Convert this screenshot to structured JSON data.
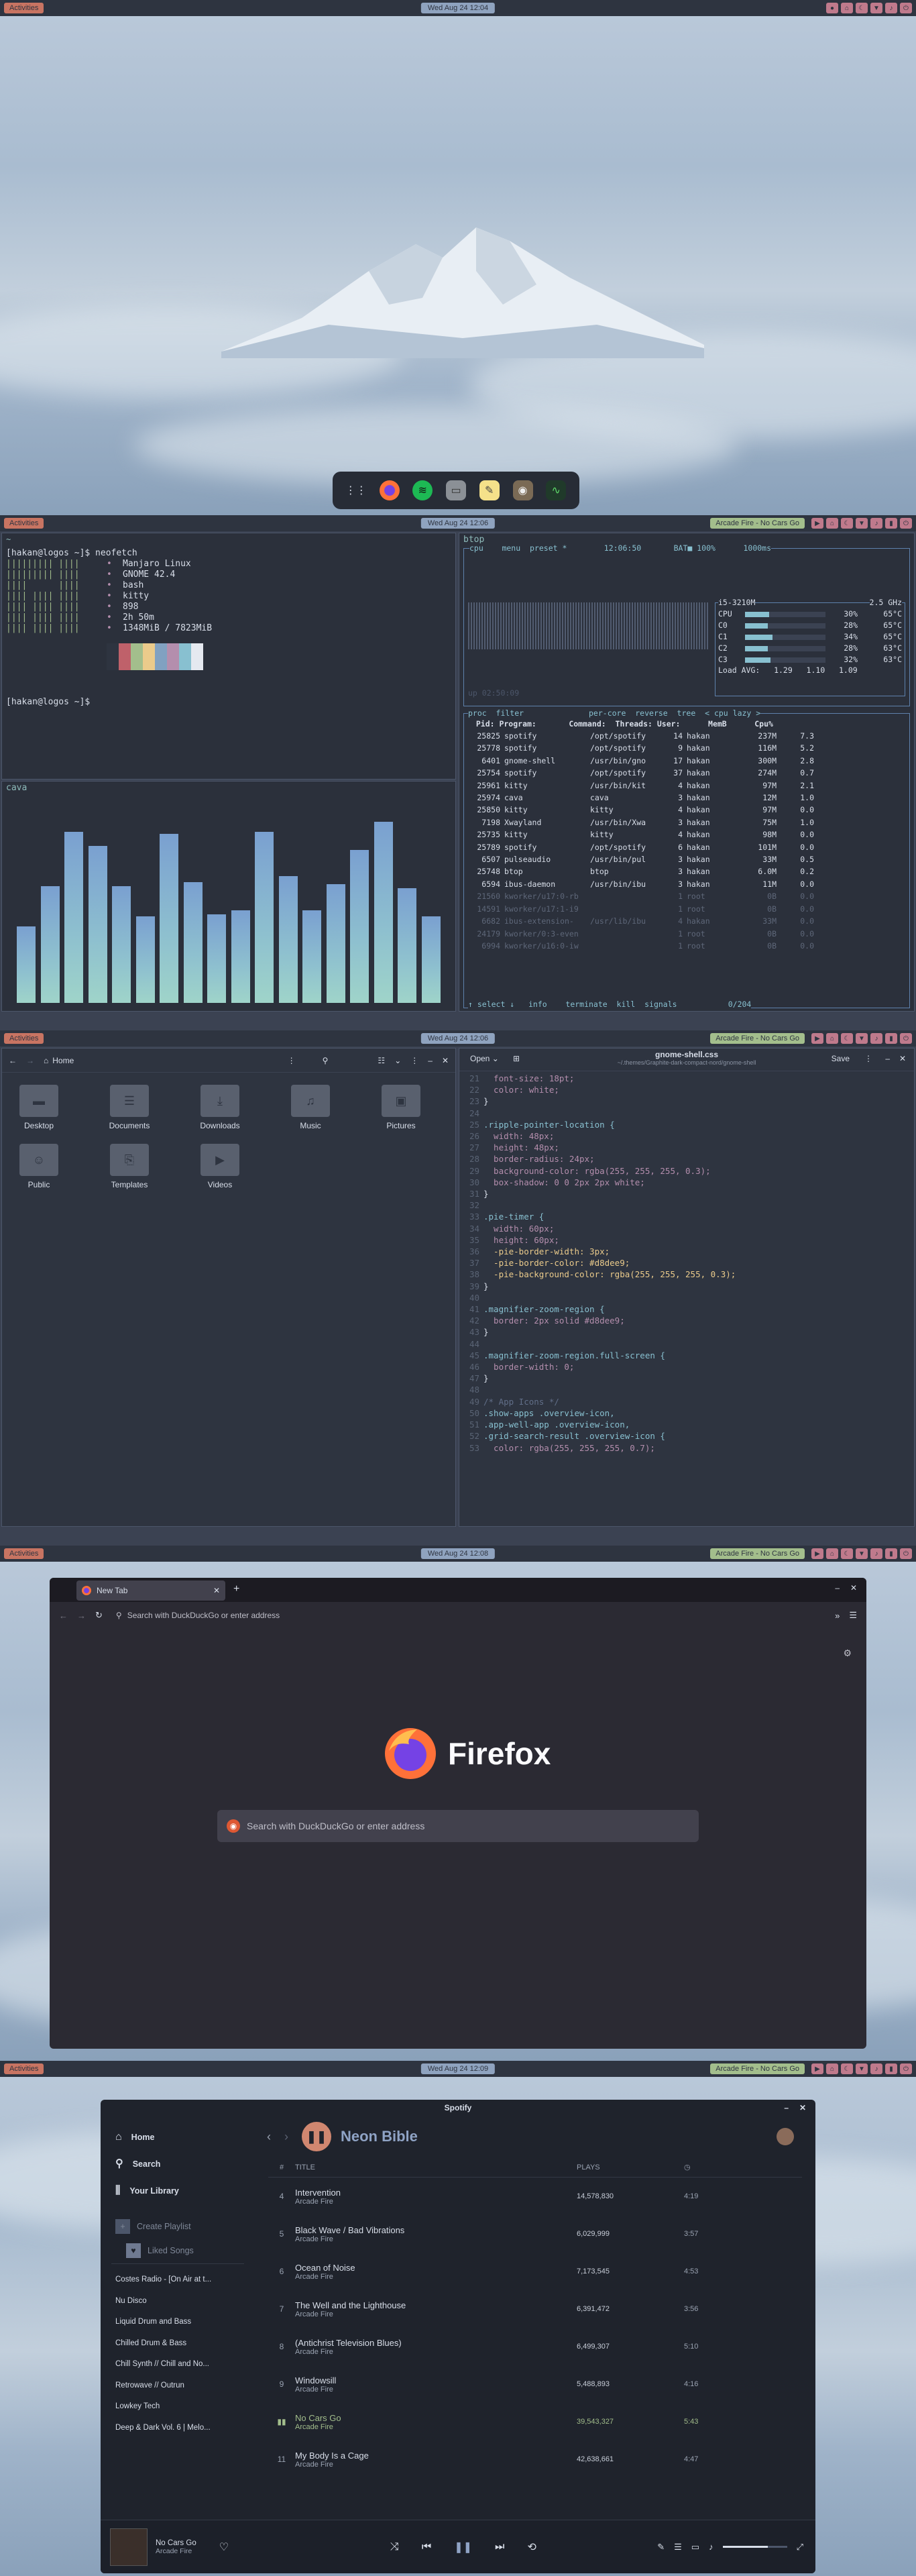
{
  "screens": [
    {
      "activities": "Activities",
      "clock": "Wed Aug 24 12:04"
    },
    {
      "activities": "Activities",
      "clock": "Wed Aug 24 12:06",
      "music": "Arcade Fire - No Cars Go"
    },
    {
      "activities": "Activities",
      "clock": "Wed Aug 24 12:06",
      "music": "Arcade Fire - No Cars Go"
    },
    {
      "activities": "Activities",
      "clock": "Wed Aug 24 12:08",
      "music": "Arcade Fire - No Cars Go"
    },
    {
      "activities": "Activities",
      "clock": "Wed Aug 24 12:09",
      "music": "Arcade Fire - No Cars Go"
    }
  ],
  "dock": [
    "apps-grid-icon",
    "firefox-icon",
    "spotify-icon",
    "files-icon",
    "notes-icon",
    "gimp-icon",
    "system-monitor-icon"
  ],
  "term_left": {
    "prompt1": "[hakan@logos ~]$ neofetch",
    "prompt2": "[hakan@logos ~]$",
    "title": "~",
    "logo": [
      "||||||||| ||||",
      "||||||||| ||||",
      "||||      ||||",
      "|||| |||| ||||",
      "|||| |||| ||||",
      "|||| |||| ||||",
      "|||| |||| ||||"
    ],
    "info": [
      "Manjaro Linux",
      "GNOME 42.4",
      "bash",
      "kitty",
      "898",
      "2h 50m",
      "1348MiB / 7823MiB"
    ],
    "palette": [
      "#2e3440",
      "#bf616a",
      "#a3be8c",
      "#ebcb8b",
      "#81a1c1",
      "#b48ead",
      "#88c0d0",
      "#e5e9f0"
    ],
    "cava_title": "cava",
    "cava_levels": [
      0.38,
      0.58,
      0.85,
      0.78,
      0.58,
      0.43,
      0.84,
      0.6,
      0.44,
      0.46,
      0.85,
      0.63,
      0.46,
      0.59,
      0.76,
      0.9,
      0.57,
      0.43
    ]
  },
  "btop": {
    "title": "btop",
    "header": "cpu    menu  preset *        12:06:50       BAT■ 100%      1000ms",
    "cpu_model": "i5-3210M",
    "ghz": "2.5 GHz",
    "cores": [
      [
        "CPU",
        "30%",
        "65°C"
      ],
      [
        "C0",
        "28%",
        "65°C"
      ],
      [
        "C1",
        "34%",
        "65°C"
      ],
      [
        "C2",
        "28%",
        "63°C"
      ],
      [
        "C3",
        "32%",
        "63°C"
      ]
    ],
    "load": "Load AVG:   1.29   1.10   1.09",
    "uptime": "up 02:50:09",
    "proc_header": "proc  filter              per-core  reverse  tree  < cpu lazy >",
    "cols": "  Pid: Program:       Command:  Threads: User:      MemB      Cpu%",
    "rows": [
      [
        "25825",
        "spotify",
        "/opt/spotify",
        "14",
        "hakan",
        "237M",
        "7.3"
      ],
      [
        "25778",
        "spotify",
        "/opt/spotify",
        "9",
        "hakan",
        "116M",
        "5.2"
      ],
      [
        "6401",
        "gnome-shell",
        "/usr/bin/gno",
        "17",
        "hakan",
        "300M",
        "2.8"
      ],
      [
        "25754",
        "spotify",
        "/opt/spotify",
        "37",
        "hakan",
        "274M",
        "0.7"
      ],
      [
        "25961",
        "kitty",
        "/usr/bin/kit",
        "4",
        "hakan",
        "97M",
        "2.1"
      ],
      [
        "25974",
        "cava",
        "cava",
        "3",
        "hakan",
        "12M",
        "1.0"
      ],
      [
        "25850",
        "kitty",
        "kitty",
        "4",
        "hakan",
        "97M",
        "0.0"
      ],
      [
        "7198",
        "Xwayland",
        "/usr/bin/Xwa",
        "3",
        "hakan",
        "75M",
        "1.0"
      ],
      [
        "25735",
        "kitty",
        "kitty",
        "4",
        "hakan",
        "98M",
        "0.0"
      ],
      [
        "25789",
        "spotify",
        "/opt/spotify",
        "6",
        "hakan",
        "101M",
        "0.0"
      ],
      [
        "6507",
        "pulseaudio",
        "/usr/bin/pul",
        "3",
        "hakan",
        "33M",
        "0.5"
      ],
      [
        "25748",
        "btop",
        "btop",
        "3",
        "hakan",
        "6.0M",
        "0.2"
      ],
      [
        "6594",
        "ibus-daemon",
        "/usr/bin/ibu",
        "3",
        "hakan",
        "11M",
        "0.0"
      ],
      [
        "21560",
        "kworker/u17:0-rb",
        "",
        "1",
        "root",
        "0B",
        "0.0"
      ],
      [
        "14591",
        "kworker/u17:1-i9",
        "",
        "1",
        "root",
        "0B",
        "0.0"
      ],
      [
        "6682",
        "ibus-extension-",
        "/usr/lib/ibu",
        "4",
        "hakan",
        "33M",
        "0.0"
      ],
      [
        "24179",
        "kworker/0:3-even",
        "",
        "1",
        "root",
        "0B",
        "0.0"
      ],
      [
        "6994",
        "kworker/u16:0-iw",
        "",
        "1",
        "root",
        "0B",
        "0.0"
      ]
    ],
    "footer": "↑ select ↓   info    terminate  kill  signals           0/204"
  },
  "files": {
    "location": "Home",
    "folders": [
      "Desktop",
      "Documents",
      "Downloads",
      "Music",
      "Pictures",
      "Public",
      "Templates",
      "Videos"
    ]
  },
  "editor": {
    "open": "Open",
    "filename": "gnome-shell.css",
    "path": "~/.themes/Graphite-dark-compact-nord/gnome-shell",
    "save": "Save",
    "lines": [
      [
        "21",
        "  font-size: 18pt;"
      ],
      [
        "22",
        "  color: white;"
      ],
      [
        "23",
        "}"
      ],
      [
        "24",
        ""
      ],
      [
        "25",
        ".ripple-pointer-location {"
      ],
      [
        "26",
        "  width: 48px;"
      ],
      [
        "27",
        "  height: 48px;"
      ],
      [
        "28",
        "  border-radius: 24px;"
      ],
      [
        "29",
        "  background-color: rgba(255, 255, 255, 0.3);"
      ],
      [
        "30",
        "  box-shadow: 0 0 2px 2px white;"
      ],
      [
        "31",
        "}"
      ],
      [
        "32",
        ""
      ],
      [
        "33",
        ".pie-timer {"
      ],
      [
        "34",
        "  width: 60px;"
      ],
      [
        "35",
        "  height: 60px;"
      ],
      [
        "36",
        "  -pie-border-width: 3px;"
      ],
      [
        "37",
        "  -pie-border-color: #d8dee9;"
      ],
      [
        "38",
        "  -pie-background-color: rgba(255, 255, 255, 0.3);"
      ],
      [
        "39",
        "}"
      ],
      [
        "40",
        ""
      ],
      [
        "41",
        ".magnifier-zoom-region {"
      ],
      [
        "42",
        "  border: 2px solid #d8dee9;"
      ],
      [
        "43",
        "}"
      ],
      [
        "44",
        ""
      ],
      [
        "45",
        ".magnifier-zoom-region.full-screen {"
      ],
      [
        "46",
        "  border-width: 0;"
      ],
      [
        "47",
        "}"
      ],
      [
        "48",
        ""
      ],
      [
        "49",
        "/* App Icons */"
      ],
      [
        "50",
        ".show-apps .overview-icon,"
      ],
      [
        "51",
        ".app-well-app .overview-icon,"
      ],
      [
        "52",
        ".grid-search-result .overview-icon {"
      ],
      [
        "53",
        "  color: rgba(255, 255, 255, 0.7);"
      ]
    ]
  },
  "firefox": {
    "tab": "New Tab",
    "url_placeholder": "Search with DuckDuckGo or enter address",
    "brand": "Firefox",
    "search_placeholder": "Search with DuckDuckGo or enter address"
  },
  "spotify": {
    "title": "Spotify",
    "nav": [
      "Home",
      "Search",
      "Your Library"
    ],
    "create": "Create Playlist",
    "liked": "Liked Songs",
    "playlists": [
      "Costes Radio - [On Air at t...",
      "Nu Disco",
      "Liquid Drum and Bass",
      "Chilled Drum & Bass",
      "Chill Synth // Chill and No...",
      "Retrowave // Outrun",
      "Lowkey Tech",
      "Deep & Dark Vol. 6 | Melo..."
    ],
    "album": "Neon Bible",
    "col_num": "#",
    "col_title": "TITLE",
    "col_plays": "PLAYS",
    "tracks": [
      {
        "n": "4",
        "title": "Intervention",
        "artist": "Arcade Fire",
        "plays": "14,578,830",
        "time": "4:19"
      },
      {
        "n": "5",
        "title": "Black Wave / Bad Vibrations",
        "artist": "Arcade Fire",
        "plays": "6,029,999",
        "time": "3:57"
      },
      {
        "n": "6",
        "title": "Ocean of Noise",
        "artist": "Arcade Fire",
        "plays": "7,173,545",
        "time": "4:53"
      },
      {
        "n": "7",
        "title": "The Well and the Lighthouse",
        "artist": "Arcade Fire",
        "plays": "6,391,472",
        "time": "3:56"
      },
      {
        "n": "8",
        "title": "(Antichrist Television Blues)",
        "artist": "Arcade Fire",
        "plays": "6,499,307",
        "time": "5:10"
      },
      {
        "n": "9",
        "title": "Windowsill",
        "artist": "Arcade Fire",
        "plays": "5,488,893",
        "time": "4:16"
      },
      {
        "n": "",
        "title": "No Cars Go",
        "artist": "Arcade Fire",
        "plays": "39,543,327",
        "time": "5:43"
      },
      {
        "n": "11",
        "title": "My Body Is a Cage",
        "artist": "Arcade Fire",
        "plays": "42,638,661",
        "time": "4:47"
      }
    ],
    "now_title": "No Cars Go",
    "now_artist": "Arcade Fire",
    "volume": 0.7
  }
}
